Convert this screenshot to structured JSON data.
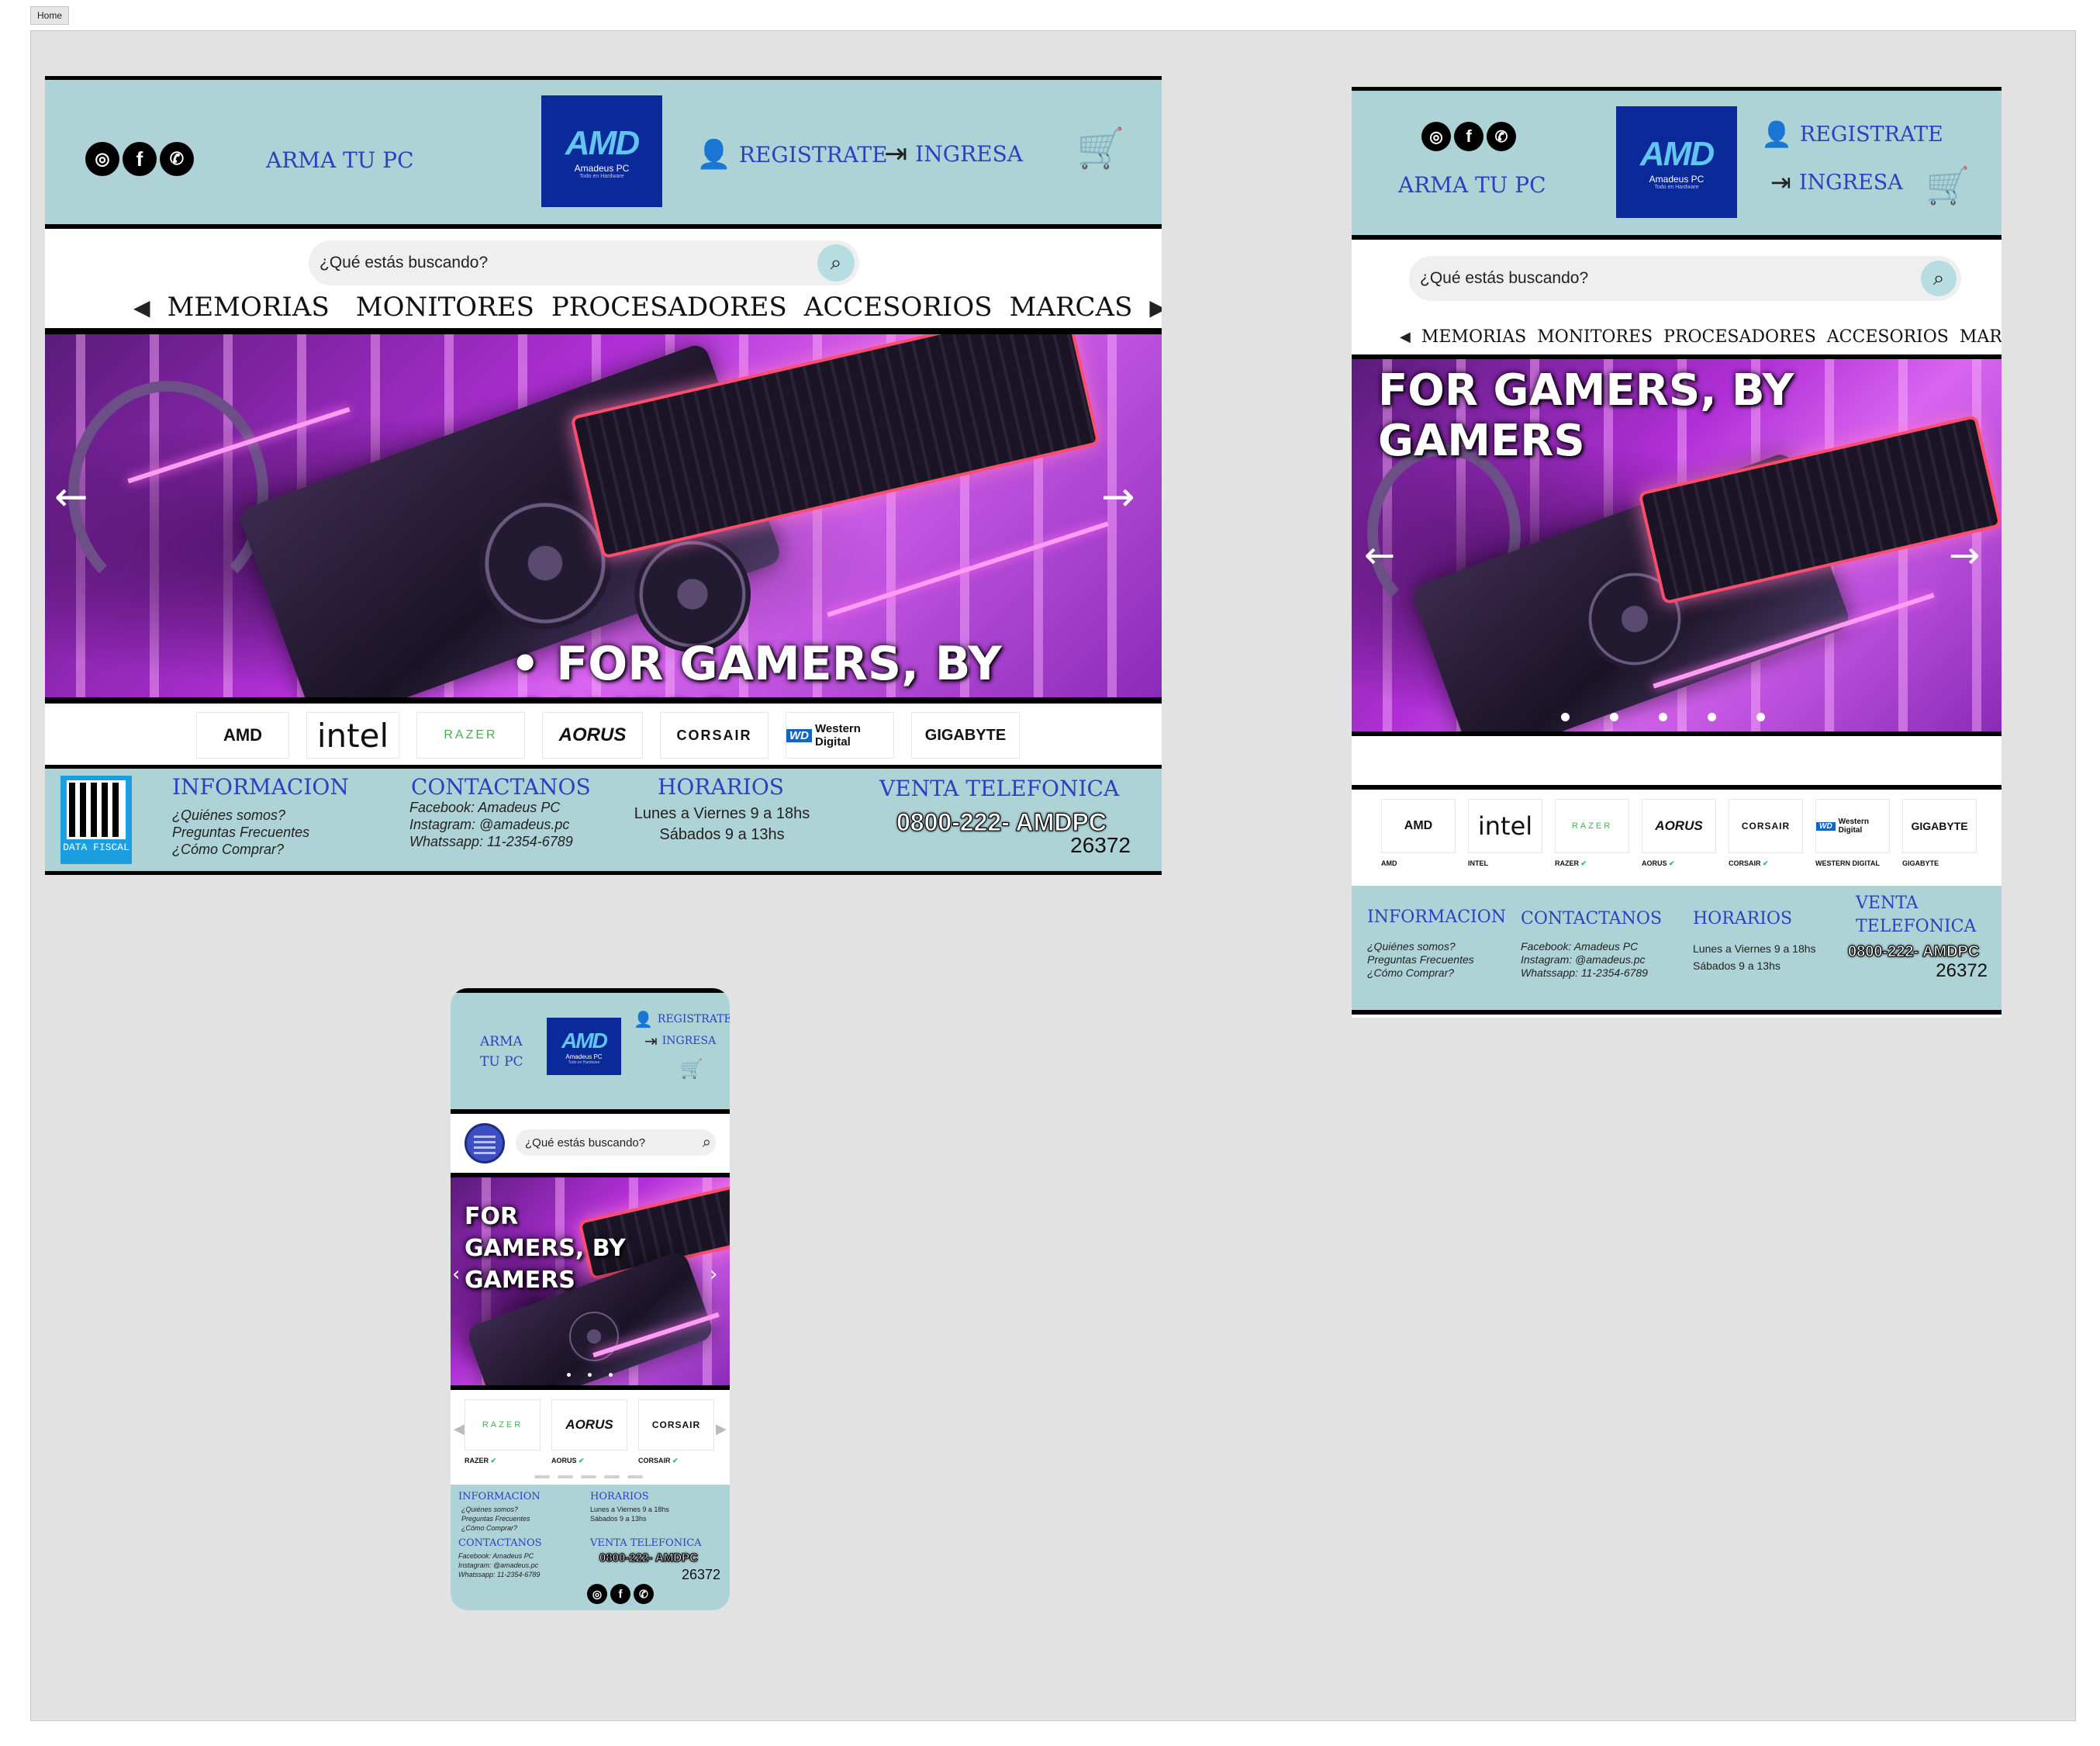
{
  "page_tab": "Home",
  "social_icons": [
    "instagram-icon",
    "facebook-icon",
    "whatsapp-icon"
  ],
  "header": {
    "arma_label": "ARMA TU PC",
    "arma_line1": "ARMA",
    "arma_line2": "TU PC",
    "register_label": "REGISTRATE",
    "login_label": "INGRESA",
    "logo_mark": "AMD",
    "logo_name": "Amadeus PC",
    "logo_tagline": "Todo en Hardware"
  },
  "search": {
    "placeholder": "¿Qué estás buscando?"
  },
  "categories": [
    "MEMORIAS",
    "MONITORES",
    "PROCESADORES",
    "ACCESORIOS",
    "MARCAS"
  ],
  "banner": {
    "slogan": "FOR GAMERS, BY GAMERS",
    "slogan_desktop": "• FOR GAMERS, BY GAMERS",
    "mobile_l1": "FOR",
    "mobile_l2": "GAMERS, BY",
    "mobile_l3": "GAMERS"
  },
  "brands": [
    {
      "name": "AMD",
      "caption": "AMD"
    },
    {
      "name": "intel",
      "caption": "INTEL"
    },
    {
      "name": "RAZER",
      "caption": "RAZER"
    },
    {
      "name": "AORUS",
      "caption": "AORUS"
    },
    {
      "name": "CORSAIR",
      "caption": "CORSAIR"
    },
    {
      "name": "Western Digital",
      "caption": "WESTERN DIGITAL"
    },
    {
      "name": "GIGABYTE",
      "caption": "GIGABYTE"
    }
  ],
  "footer": {
    "info_title": "INFORMACION",
    "info_items": [
      "¿Quiénes somos?",
      "Preguntas Frecuentes",
      "¿Cómo Comprar?"
    ],
    "contact_title": "CONTACTANOS",
    "contact_items": [
      "Facebook: Amadeus PC",
      "Instagram: @amadeus.pc",
      "Whatssapp: 11-2354-6789"
    ],
    "hours_title": "HORARIOS",
    "hours_items": [
      "Lunes a Viernes 9 a 18hs",
      "Sábados 9 a 13hs"
    ],
    "phone_title": "VENTA TELEFONICA",
    "phone_title_l1": "VENTA",
    "phone_title_l2": "TELEFONICA",
    "phone_main": "0800-222- AMDPC",
    "phone_number": "26372",
    "qr_caption": "DATA FISCAL"
  },
  "colors": {
    "header_bg": "#aed3d6",
    "link": "#2f3fbf",
    "logo_bg": "#0b2a9a"
  }
}
